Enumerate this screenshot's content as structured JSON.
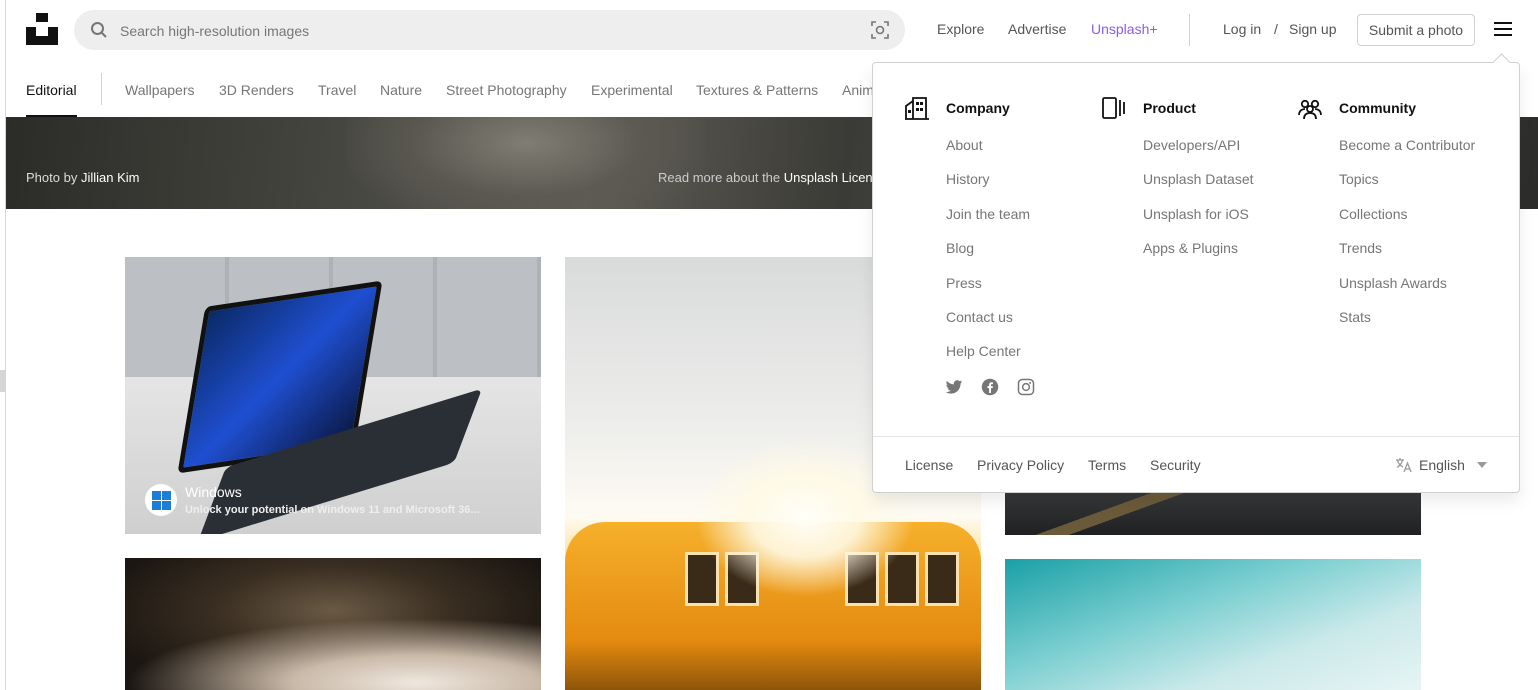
{
  "header": {
    "search_placeholder": "Search high-resolution images",
    "nav": {
      "explore": "Explore",
      "advertise": "Advertise",
      "unsplash_plus": "Unsplash+"
    },
    "auth": {
      "login": "Log in",
      "slash": "/",
      "signup": "Sign up"
    },
    "submit_label": "Submit a photo",
    "accent_color": "#8b5cf6"
  },
  "topics": [
    "Editorial",
    "Wallpapers",
    "3D Renders",
    "Travel",
    "Nature",
    "Street Photography",
    "Experimental",
    "Textures & Patterns",
    "Anim"
  ],
  "hero": {
    "photo_word": "Photo",
    "by_word": "by",
    "photographer": "Jillian Kim",
    "license_prefix": "Read more about the",
    "license_link": "Unsplash Licen"
  },
  "ad": {
    "title": "Windows",
    "subtitle": "Unlock your potential on Windows 11 and Microsoft 36..."
  },
  "dropdown": {
    "company": {
      "title": "Company",
      "icon": "building-icon",
      "items": [
        "About",
        "History",
        "Join the team",
        "Blog",
        "Press",
        "Contact us",
        "Help Center"
      ]
    },
    "product": {
      "title": "Product",
      "icon": "device-icon",
      "items": [
        "Developers/API",
        "Unsplash Dataset",
        "Unsplash for iOS",
        "Apps & Plugins"
      ]
    },
    "community": {
      "title": "Community",
      "icon": "people-icon",
      "items": [
        "Become a Contributor",
        "Topics",
        "Collections",
        "Trends",
        "Unsplash Awards",
        "Stats"
      ]
    },
    "socials": [
      "twitter-icon",
      "facebook-icon",
      "instagram-icon"
    ],
    "footer": {
      "links": [
        "License",
        "Privacy Policy",
        "Terms",
        "Security"
      ],
      "language": "English"
    }
  }
}
